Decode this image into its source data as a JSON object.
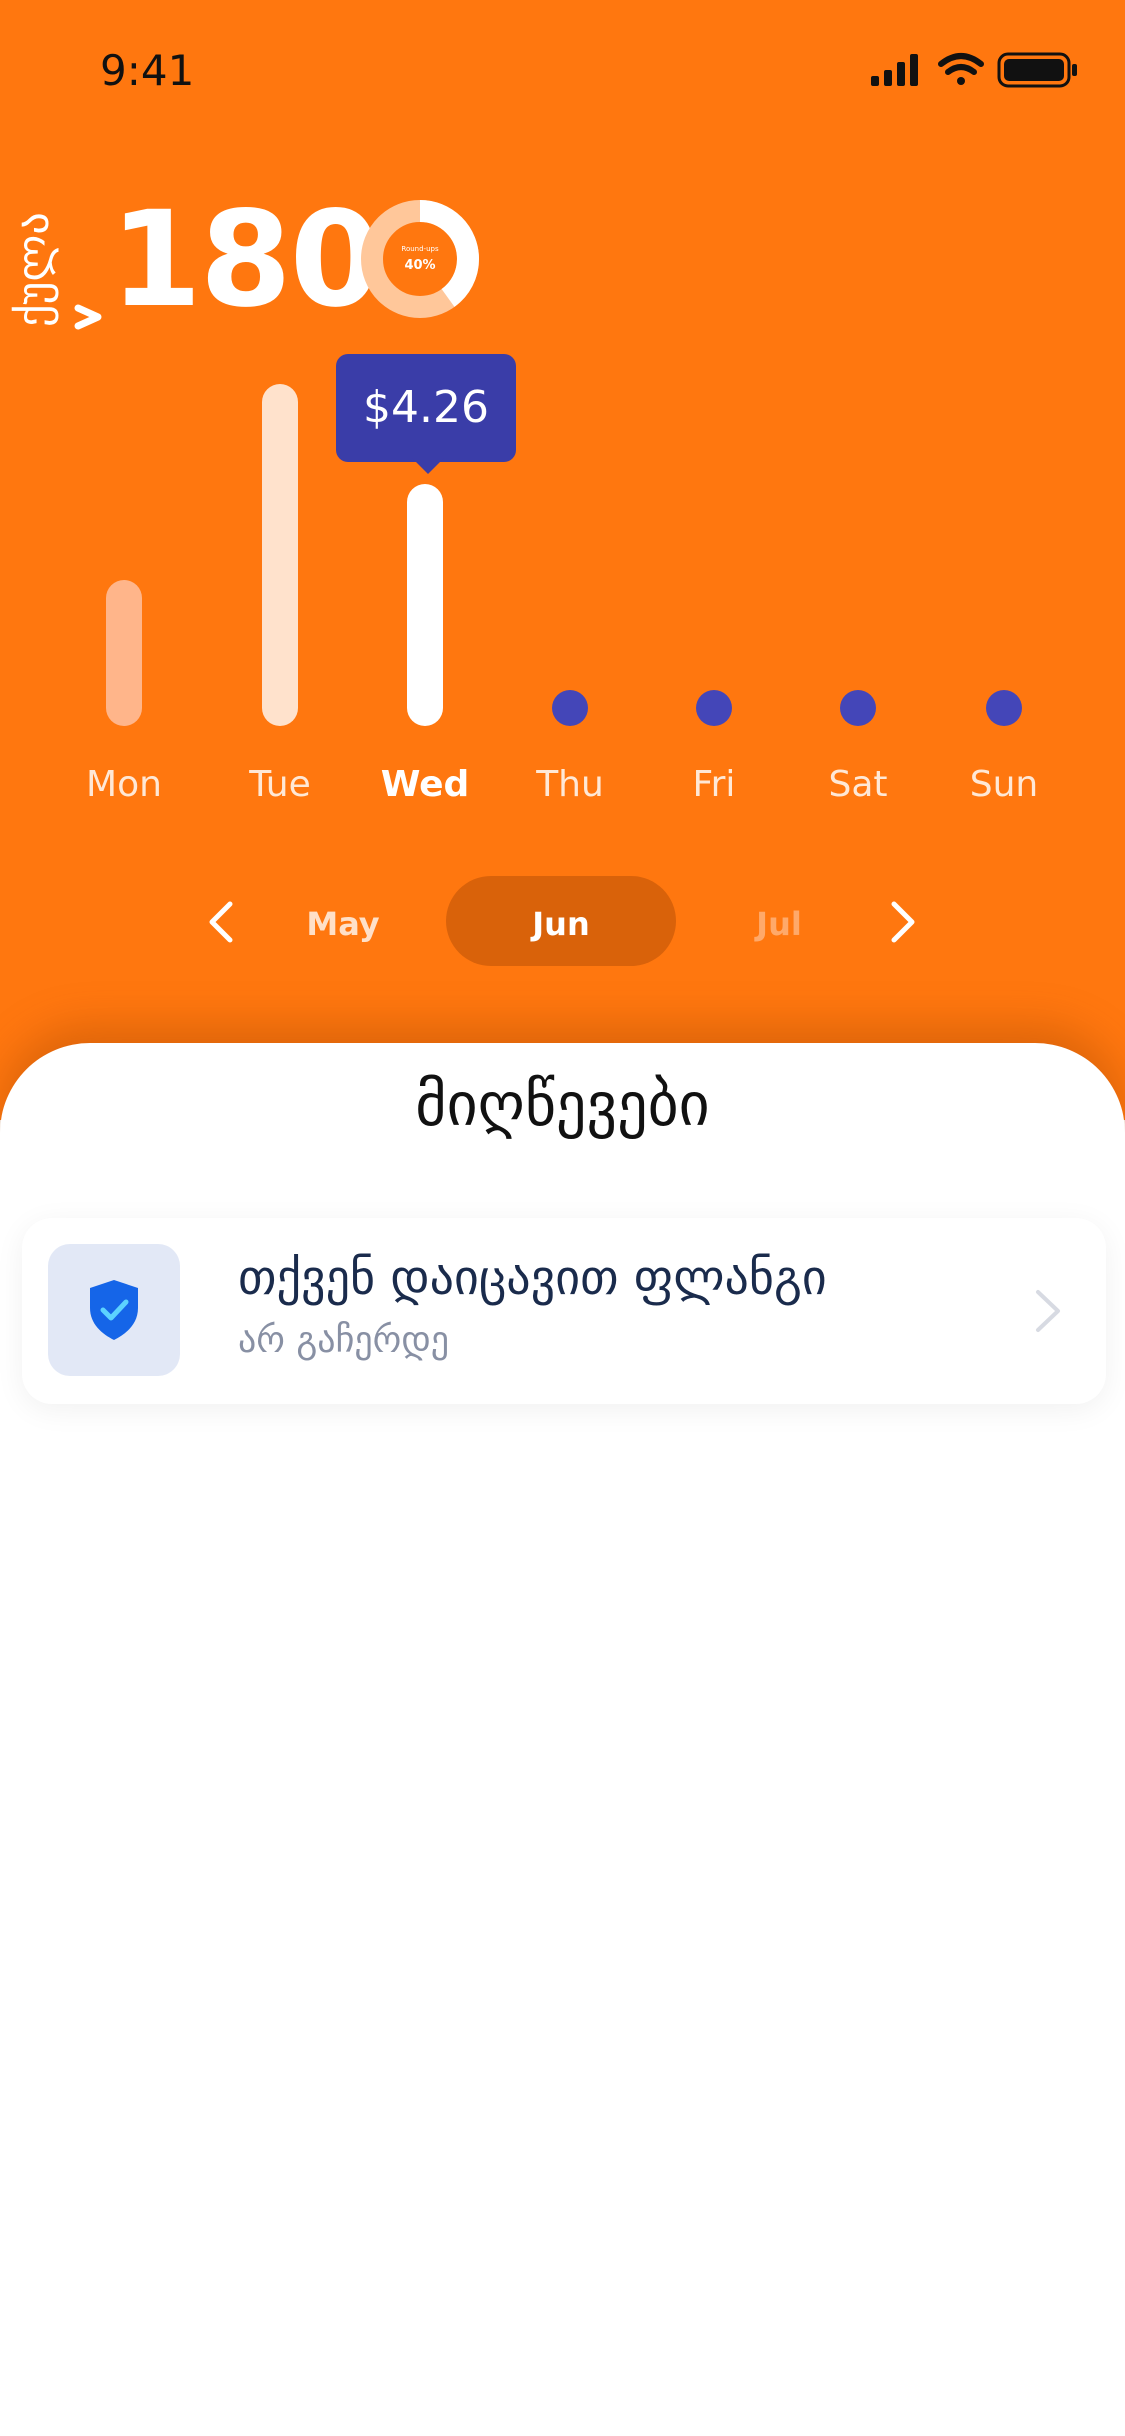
{
  "status_bar": {
    "time": "9:41"
  },
  "header": {
    "vertical_label": "ქულა",
    "value": "180",
    "donut": {
      "label": "Round-ups",
      "percent_text": "40%",
      "percent": 40
    }
  },
  "chart_data": {
    "type": "bar",
    "categories": [
      "Mon",
      "Tue",
      "Wed",
      "Thu",
      "Fri",
      "Sat",
      "Sun"
    ],
    "values": [
      1.46,
      3.42,
      2.42,
      0,
      0,
      0,
      0
    ],
    "selected_index": 2,
    "tooltip": "$4.26",
    "title": "",
    "xlabel": "",
    "ylabel": ""
  },
  "month_nav": {
    "prev": "May",
    "current": "Jun",
    "next": "Jul"
  },
  "achievements": {
    "title": "მიღწევები",
    "items": [
      {
        "title": "თქვენ დაიცავით ფლანგი",
        "subtitle": "არ გაჩერდე",
        "icon": "shield-check-icon"
      }
    ]
  },
  "colors": {
    "primary": "#FF770F",
    "accent": "#3A3DA8",
    "active_month": "#D9620A"
  }
}
